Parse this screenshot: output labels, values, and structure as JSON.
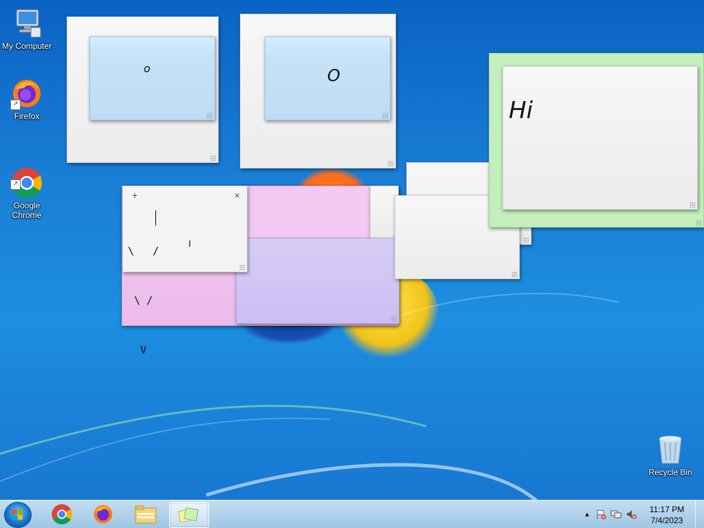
{
  "desktop": {
    "icons": [
      {
        "label": "My Computer",
        "icon": "computer-icon"
      },
      {
        "label": "Firefox",
        "icon": "firefox-icon"
      },
      {
        "label": "Google\nChrome",
        "icon": "chrome-icon"
      },
      {
        "label": "Recycle Bin",
        "icon": "recycle-bin-icon"
      }
    ]
  },
  "notes": {
    "note1_text": "o",
    "note2_text": "O",
    "note3_text": "Hi",
    "active_note": {
      "add_button": "+",
      "close_button": "×",
      "line1": "\\   /",
      "line2": " \\ /",
      "line3": "  V"
    }
  },
  "taskbar": {
    "start_icon": "windows-start-icon",
    "pinned": [
      "chrome-icon",
      "firefox-icon",
      "file-explorer-icon",
      "sticky-notes-icon"
    ],
    "tray": {
      "chevron": "▲",
      "icons": [
        "action-center-flag-icon",
        "network-icon",
        "volume-muted-icon"
      ]
    },
    "clock": {
      "time": "11:17 PM",
      "date": "7/4/2023"
    }
  }
}
